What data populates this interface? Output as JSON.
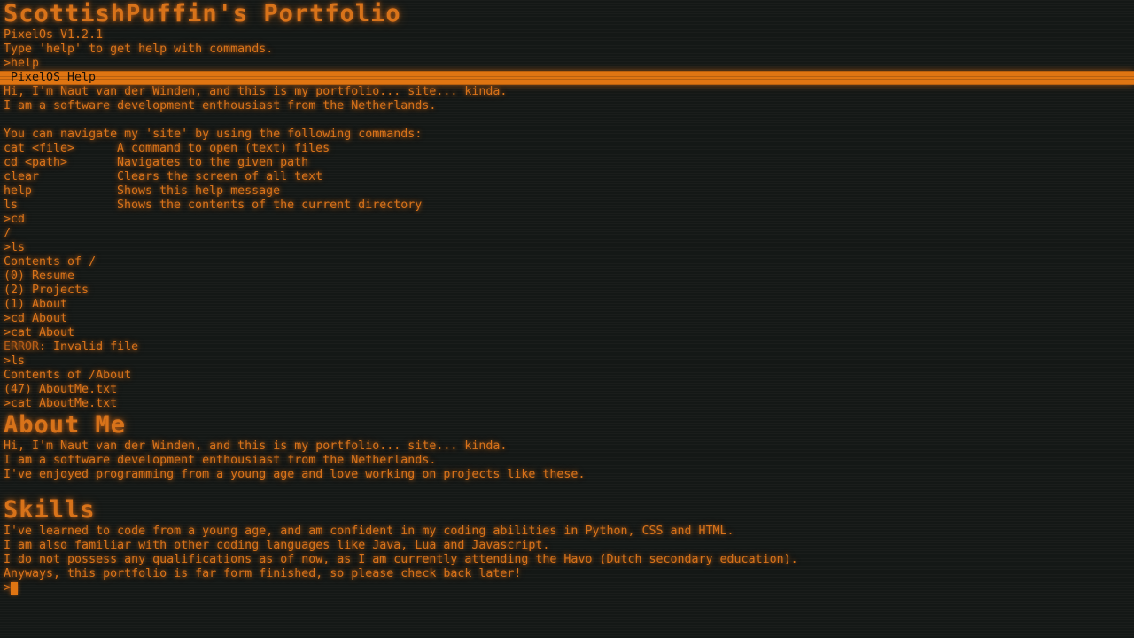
{
  "title": "ScottishPuffin's Portfolio",
  "version": "PixelOs V1.2.1",
  "hint": "Type 'help' to get help with commands.",
  "lines": {
    "cmd_help": ">help",
    "help_bar_title": "PixelOS Help",
    "intro1": "Hi, I'm Naut van der Winden, and this is my portfolio... site... kinda.",
    "intro2": "I am a software development enthousiast from the Netherlands.",
    "nav_text": "You can navigate my 'site' by using the following commands:",
    "cmd_cd": ">cd",
    "slash": "/",
    "cmd_ls": ">ls",
    "contents_root": "Contents of /",
    "item_resume": "(0) Resume",
    "item_projects": "(2) Projects",
    "item_about": "(1) About",
    "cmd_cd_about": ">cd About",
    "cmd_cat_about": ">cat About",
    "error_tag": "ERROR",
    "error_msg": ": Invalid file",
    "cmd_ls2": ">ls",
    "contents_about": "Contents of /About",
    "item_aboutme": "(47) AboutMe.txt",
    "cmd_cat_aboutme": ">cat AboutMe.txt"
  },
  "commands": [
    {
      "name": "cat <file>",
      "desc": "A command to open (text) files"
    },
    {
      "name": "cd <path>",
      "desc": "Navigates to the given path"
    },
    {
      "name": "clear",
      "desc": "Clears the screen of all text"
    },
    {
      "name": "help",
      "desc": "Shows this help message"
    },
    {
      "name": "ls",
      "desc": "Shows the contents of the current directory"
    }
  ],
  "about": {
    "heading": "About Me",
    "line1": "Hi, I'm Naut van der Winden, and this is my portfolio... site... kinda.",
    "line2": "I am a software development enthousiast from the Netherlands.",
    "line3": "I've enjoyed programming from a young age and love working on projects like these."
  },
  "skills": {
    "heading": "Skills",
    "line1": "I've learned to code from a young age, and am confident in my coding abilities in Python, CSS and HTML.",
    "line2": "I am also familiar with other coding languages like Java, Lua and Javascript.",
    "line3": "I do not possess any qualifications as of now, as I am currently attending the Havo (Dutch secondary education).",
    "line4": "Anyways, this portfolio is far form finished, so please check back later!"
  },
  "prompt": ">",
  "colors": {
    "text": "#d8731a",
    "background": "#141816",
    "help_bar": "#e07512"
  }
}
